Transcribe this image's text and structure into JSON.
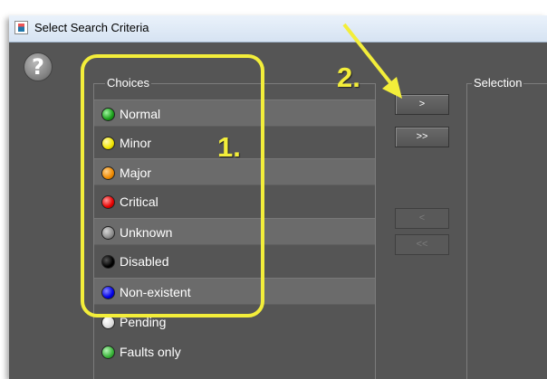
{
  "window": {
    "title": "Select Search Criteria"
  },
  "help": {
    "label": "?"
  },
  "choices": {
    "title": "Choices",
    "items": [
      {
        "label": "Normal",
        "color": "#1a9e1a"
      },
      {
        "label": "Minor",
        "color": "#f2e600"
      },
      {
        "label": "Major",
        "color": "#ef8a00"
      },
      {
        "label": "Critical",
        "color": "#e60000"
      },
      {
        "label": "Unknown",
        "color": "#8c8c8c"
      },
      {
        "label": "Disabled",
        "color": "#000000"
      },
      {
        "label": "Non-existent",
        "color": "#0000e6"
      },
      {
        "label": "Pending",
        "color": "#dcdcdc"
      },
      {
        "label": "Faults only",
        "color": "#39b339"
      }
    ]
  },
  "selection": {
    "title": "Selection"
  },
  "buttons": {
    "add": ">",
    "add_all": ">>",
    "remove": "<",
    "remove_all": "<<"
  },
  "annotations": {
    "step1": "1.",
    "step2": "2.",
    "highlight_color": "#f3ee3a"
  }
}
